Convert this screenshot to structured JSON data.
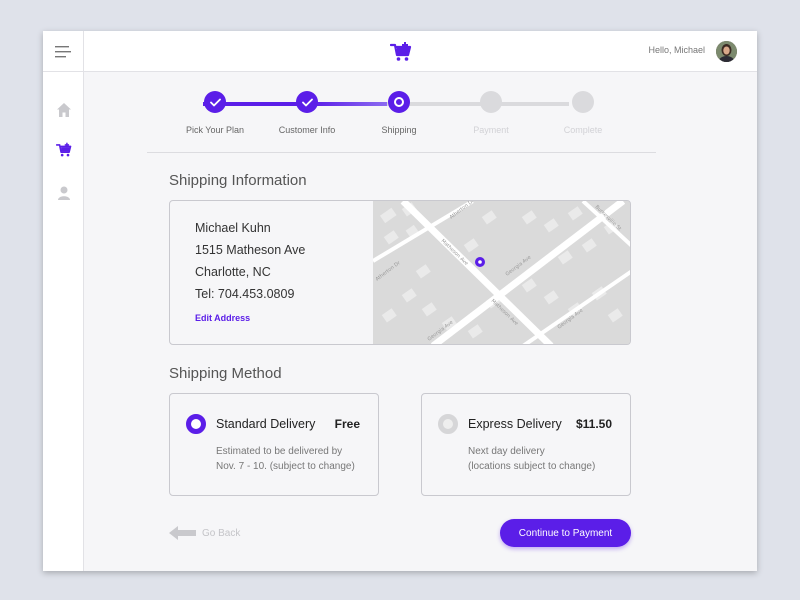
{
  "header": {
    "greeting": "Hello, Michael"
  },
  "icons": {
    "menu": "hamburger-menu-icon",
    "brand": "shopping-cart-icon",
    "sidebar": [
      "home-icon",
      "shopping-cart-icon",
      "user-icon"
    ]
  },
  "steps": [
    {
      "label": "Pick Your Plan",
      "state": "done"
    },
    {
      "label": "Customer Info",
      "state": "done"
    },
    {
      "label": "Shipping",
      "state": "current"
    },
    {
      "label": "Payment",
      "state": "upcoming"
    },
    {
      "label": "Complete",
      "state": "upcoming"
    }
  ],
  "shipping_info": {
    "title": "Shipping Information",
    "name": "Michael Kuhn",
    "street": "1515 Matheson Ave",
    "city": "Charlotte, NC",
    "phone": "Tel: 704.453.0809",
    "edit_label": "Edit Address"
  },
  "map": {
    "streets": [
      "Matheson Ave",
      "Georgia Ave",
      "Atherton Dr",
      "Burkesville St"
    ]
  },
  "shipping_method": {
    "title": "Shipping Method",
    "options": [
      {
        "name": "Standard Delivery",
        "price": "Free",
        "desc_line1": "Estimated to be delivered by",
        "desc_line2": "Nov. 7 - 10. (subject to change)",
        "selected": true
      },
      {
        "name": "Express Delivery",
        "price": "$11.50",
        "desc_line1": "Next day delivery",
        "desc_line2": "(locations subject to change)",
        "selected": false
      }
    ]
  },
  "nav": {
    "back_label": "Go Back",
    "continue_label": "Continue to Payment"
  },
  "colors": {
    "accent": "#5b1ee8",
    "inactive": "#dadadd"
  }
}
